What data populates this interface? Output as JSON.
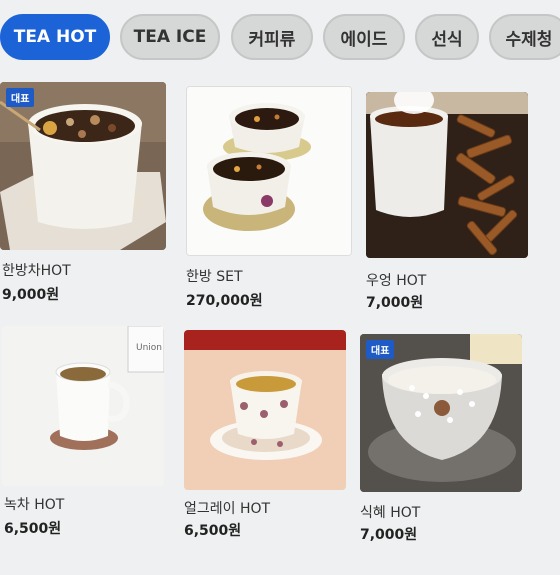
{
  "tabs": [
    {
      "label": "TEA HOT",
      "active": true
    },
    {
      "label": "TEA ICE",
      "active": false
    },
    {
      "label": "커피류",
      "active": false
    },
    {
      "label": "에이드",
      "active": false
    },
    {
      "label": "선식",
      "active": false
    },
    {
      "label": "수제청",
      "active": false
    }
  ],
  "products": [
    {
      "name": "한방차HOT",
      "price": "9,000원",
      "badge": "대표"
    },
    {
      "name": "한방 SET",
      "price": "270,000원"
    },
    {
      "name": "우엉 HOT",
      "price": "7,000원"
    },
    {
      "name": "녹차 HOT",
      "price": "6,500원"
    },
    {
      "name": "얼그레이 HOT",
      "price": "6,500원"
    },
    {
      "name": "식혜 HOT",
      "price": "7,000원",
      "badge": "대표"
    }
  ],
  "photo_lettering": {
    "cup_brand": "Union"
  },
  "colors": {
    "active_tab": "#1c63d8",
    "badge": "#1e5bc6",
    "background": "#eef0f1"
  }
}
